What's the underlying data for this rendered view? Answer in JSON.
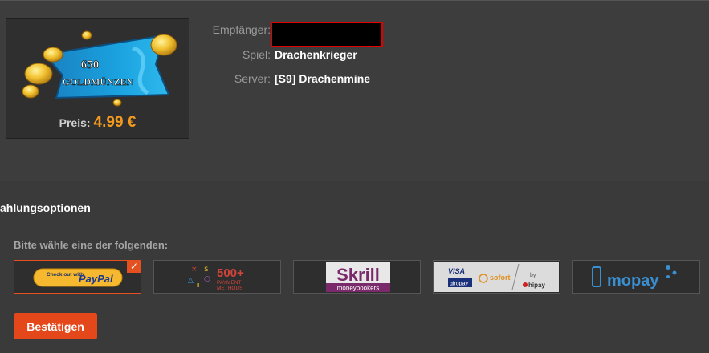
{
  "product": {
    "amount": "650",
    "currency_name": "GOLDMÜNZEN",
    "price_label": "Preis:",
    "price_value": "4.99 €"
  },
  "info": {
    "recipient_label": "Empfänger:",
    "game_label": "Spiel:",
    "game_value": "Drachenkrieger",
    "server_label": "Server:",
    "server_value": "[S9] Drachenmine"
  },
  "payment": {
    "section_title": "ahlungsoptionen",
    "prompt": "Bitte wähle eine der folgenden:",
    "paypal_small": "Check out with",
    "paypal_brand": "PayPal",
    "methods500_count": "500+",
    "methods500_line1": "PAYMENT",
    "methods500_line2": "METHODS",
    "skrill_brand": "Skrill",
    "skrill_sub": "moneybookers",
    "hipay_visa": "VISA",
    "hipay_giropay": "giropay",
    "hipay_sofort": "sofort",
    "hipay_by": "by",
    "hipay_brand": "hipay",
    "mopay_brand": "mopay"
  },
  "actions": {
    "confirm_label": "Bestätigen"
  },
  "colors": {
    "accent": "#e4501f",
    "price": "#f39a1e",
    "redaction_border": "#e00000"
  }
}
